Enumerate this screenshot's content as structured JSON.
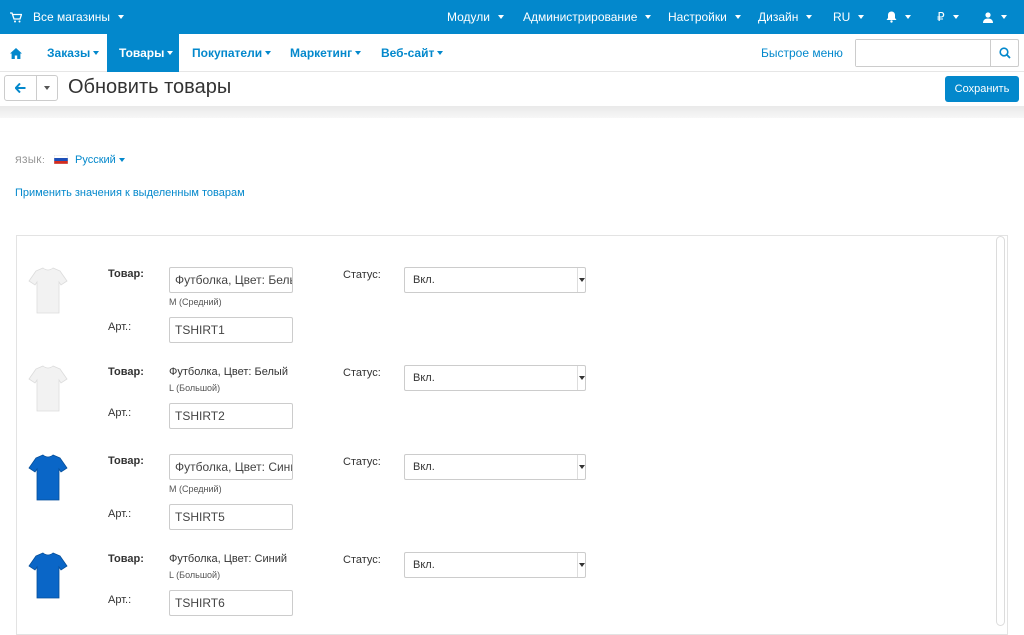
{
  "topbar": {
    "store": "Все магазины",
    "modules": "Модули",
    "admin": "Администрирование",
    "settings": "Настройки",
    "design": "Дизайн",
    "lang": "RU",
    "currency": "₽"
  },
  "nav": {
    "orders": "Заказы",
    "products": "Товары",
    "customers": "Покупатели",
    "marketing": "Маркетинг",
    "website": "Веб-сайт",
    "quick_menu": "Быстрое меню"
  },
  "search": {
    "placeholder": ""
  },
  "toolbar": {
    "title": "Обновить товары",
    "save": "Сохранить"
  },
  "language": {
    "label": "Язык:",
    "value": "Русский"
  },
  "apply_link": "Применить значения к выделенным товарам",
  "labels": {
    "product": "Товар:",
    "sku": "Арт.:",
    "status": "Статус:"
  },
  "products": [
    {
      "name": "Футболка, Цвет: Белый",
      "name_editable": true,
      "variant": "M (Средний)",
      "sku": "TSHIRT1",
      "status": "Вкл.",
      "color": "#f2f2f2"
    },
    {
      "name": "Футболка, Цвет: Белый",
      "name_editable": false,
      "variant": "L (Большой)",
      "sku": "TSHIRT2",
      "status": "Вкл.",
      "color": "#f2f2f2"
    },
    {
      "name": "Футболка, Цвет: Синий",
      "name_editable": true,
      "variant": "M (Средний)",
      "sku": "TSHIRT5",
      "status": "Вкл.",
      "color": "#0a66c7"
    },
    {
      "name": "Футболка, Цвет: Синий",
      "name_editable": false,
      "variant": "L (Большой)",
      "sku": "TSHIRT6",
      "status": "Вкл.",
      "color": "#0a66c7"
    }
  ]
}
